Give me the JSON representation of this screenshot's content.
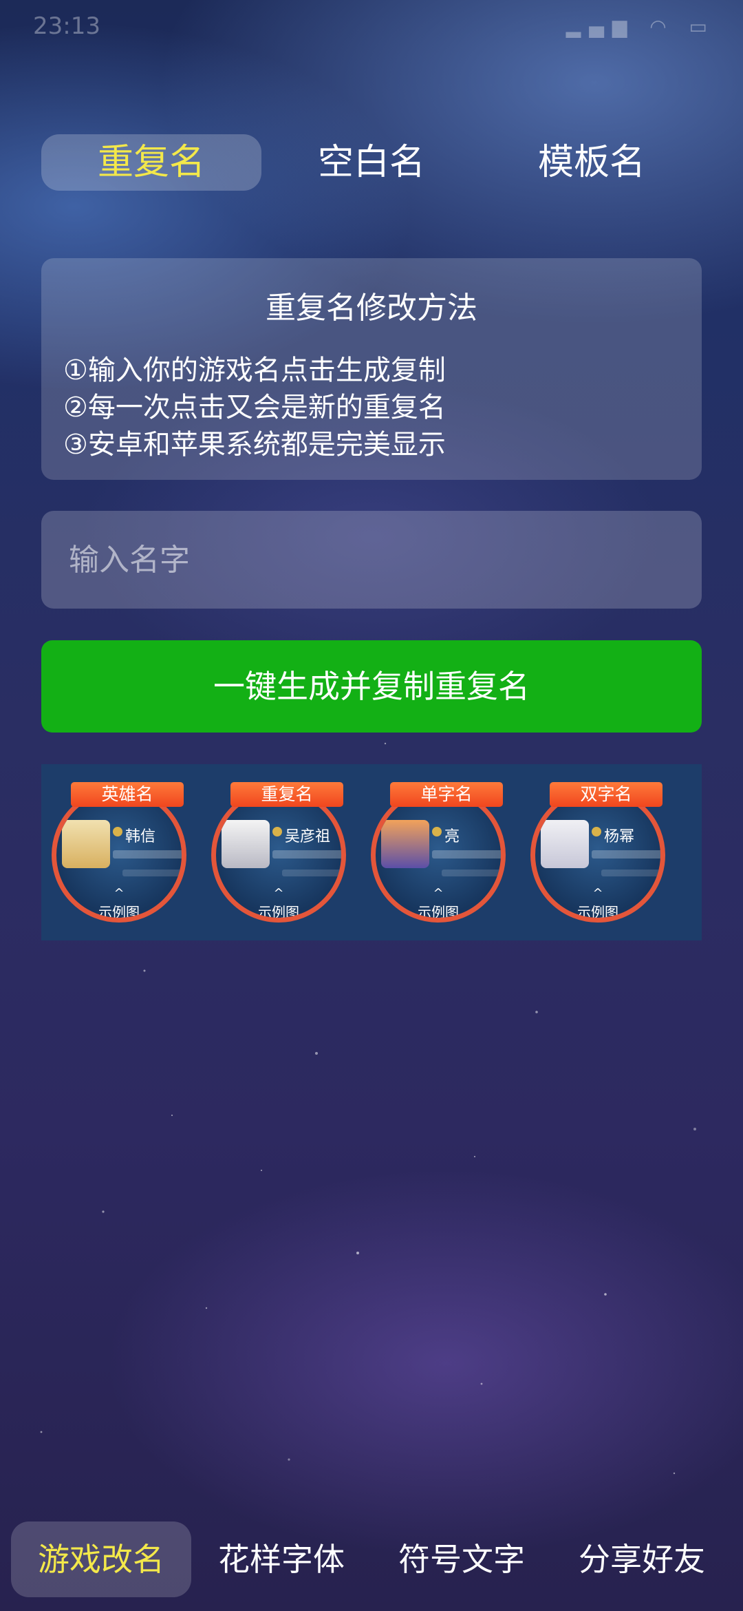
{
  "status_bar": {
    "time": "23:13",
    "icons": [
      "notification-icon",
      "signal-icon",
      "wifi-icon",
      "battery-icon"
    ]
  },
  "top_tabs": [
    {
      "label": "重复名",
      "active": true
    },
    {
      "label": "空白名",
      "active": false
    },
    {
      "label": "模板名",
      "active": false
    }
  ],
  "info_card": {
    "title": "重复名修改方法",
    "lines": [
      "①输入你的游戏名点击生成复制",
      "②每一次点击又会是新的重复名",
      "③安卓和苹果系统都是完美显示"
    ]
  },
  "name_input": {
    "placeholder": "输入名字",
    "value": ""
  },
  "generate_button": {
    "label": "一键生成并复制重复名"
  },
  "examples": [
    {
      "label": "英雄名",
      "name": "韩信",
      "caption": "示例图"
    },
    {
      "label": "重复名",
      "name": "吴彦祖",
      "caption": "示例图"
    },
    {
      "label": "单字名",
      "name": "亮",
      "caption": "示例图"
    },
    {
      "label": "双字名",
      "name": "杨幂",
      "caption": "示例图"
    }
  ],
  "bottom_nav": [
    {
      "label": "游戏改名",
      "active": true
    },
    {
      "label": "花样字体",
      "active": false
    },
    {
      "label": "符号文字",
      "active": false
    },
    {
      "label": "分享好友",
      "active": false
    }
  ],
  "colors": {
    "active_tab_text": "#f3e84a",
    "generate_button": "#13b015",
    "example_ring": "#e4563a"
  }
}
